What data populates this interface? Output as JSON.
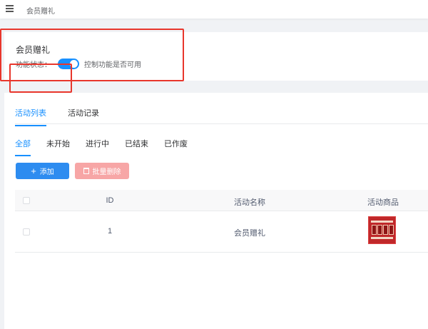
{
  "header": {
    "menu_icon": "hamburger-icon",
    "breadcrumb": "会员赠礼"
  },
  "status_card": {
    "title": "会员赠礼",
    "label": "功能状态：",
    "toggle_on": true,
    "description": "控制功能是否可用"
  },
  "tabs": [
    {
      "label": "活动列表",
      "active": true
    },
    {
      "label": "活动记录",
      "active": false
    }
  ],
  "subtabs": [
    {
      "label": "全部",
      "active": true
    },
    {
      "label": "未开始",
      "active": false
    },
    {
      "label": "进行中",
      "active": false
    },
    {
      "label": "已结束",
      "active": false
    },
    {
      "label": "已作废",
      "active": false
    }
  ],
  "actions": {
    "add_label": "添加",
    "add_icon": "plus-icon",
    "batch_delete_label": "批量删除",
    "batch_delete_icon": "trash-icon"
  },
  "table": {
    "columns": [
      "ID",
      "活动名称",
      "活动商品"
    ],
    "rows": [
      {
        "id": "1",
        "name": "会员赠礼",
        "goods_icon": "product-thumbnail"
      }
    ]
  },
  "colors": {
    "primary": "#1890ff",
    "highlight": "#e8362c",
    "danger_light": "#f7a6a6"
  }
}
